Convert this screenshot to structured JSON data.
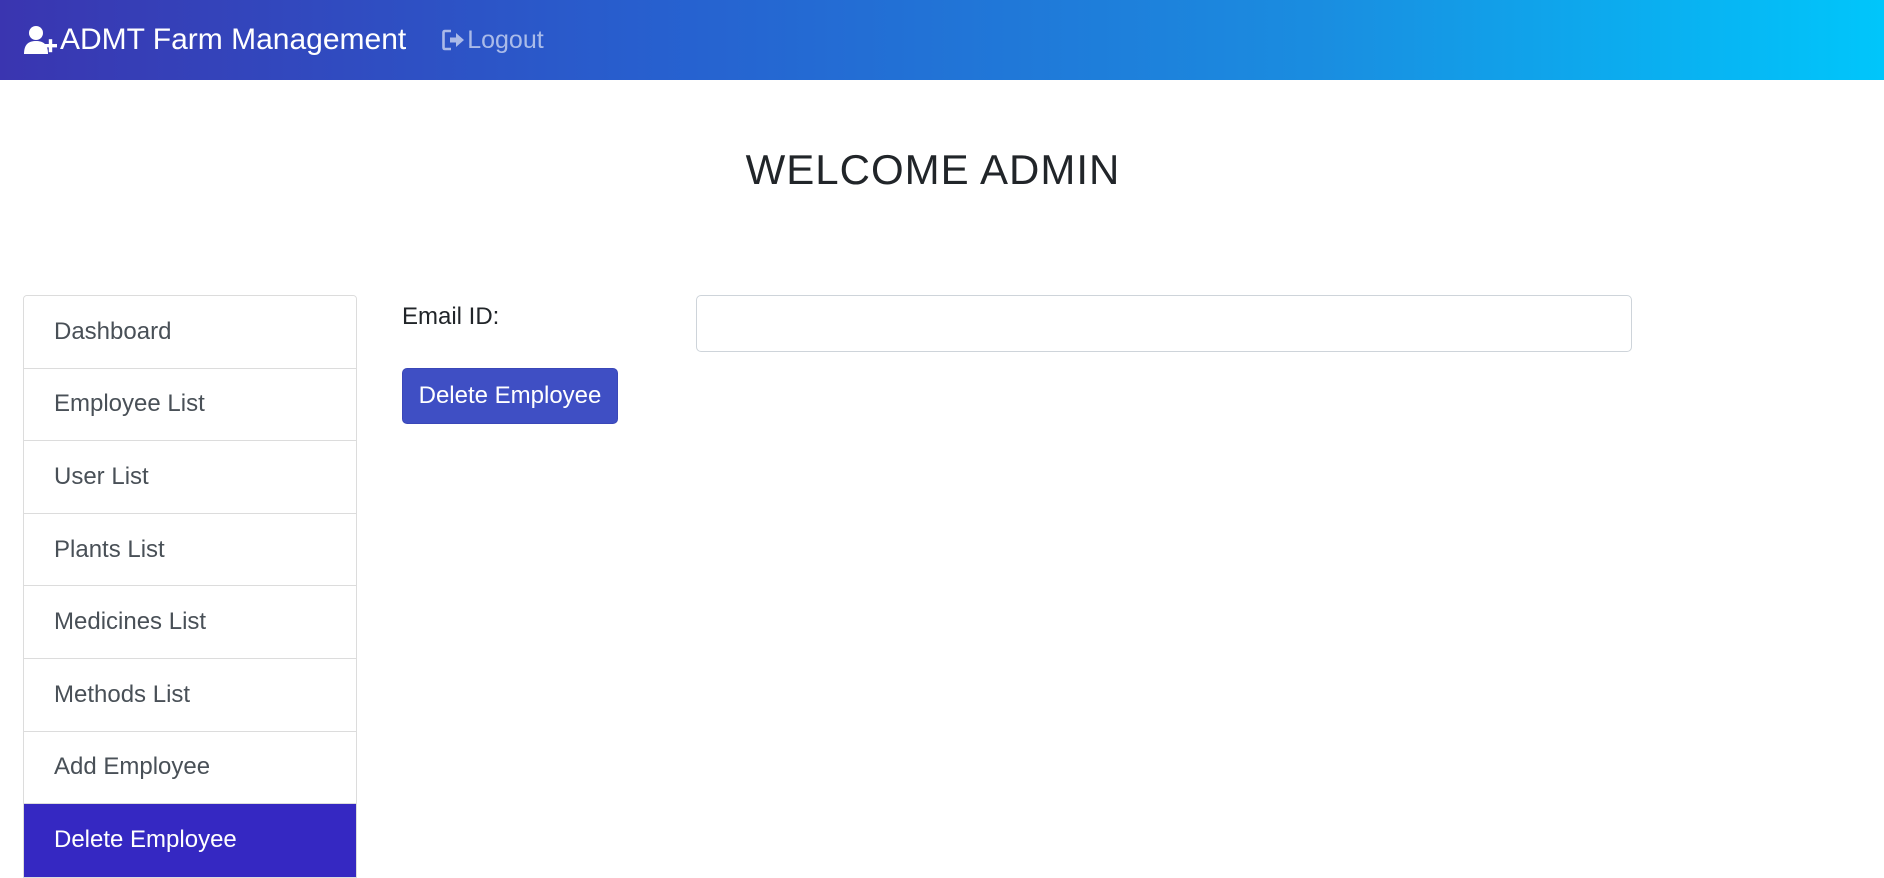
{
  "navbar": {
    "brand_icon": "user-plus-icon",
    "brand_label": "ADMT Farm Management",
    "logout_icon": "sign-out-icon",
    "logout_label": "Logout",
    "gradient_start": "#3a35b0",
    "gradient_end": "#00c6fb"
  },
  "page": {
    "title": "WELCOME ADMIN"
  },
  "sidebar": {
    "active_color": "#3528c2",
    "items": [
      {
        "label": "Dashboard"
      },
      {
        "label": "Employee List"
      },
      {
        "label": "User List"
      },
      {
        "label": "Plants List"
      },
      {
        "label": "Medicines List"
      },
      {
        "label": "Methods List"
      },
      {
        "label": "Add Employee"
      },
      {
        "label": "Delete Employee",
        "active": true
      }
    ]
  },
  "form": {
    "email_label": "Email ID:",
    "email_value": "",
    "email_placeholder": "",
    "submit_label": "Delete Employee",
    "submit_color": "#3f4fc4"
  }
}
